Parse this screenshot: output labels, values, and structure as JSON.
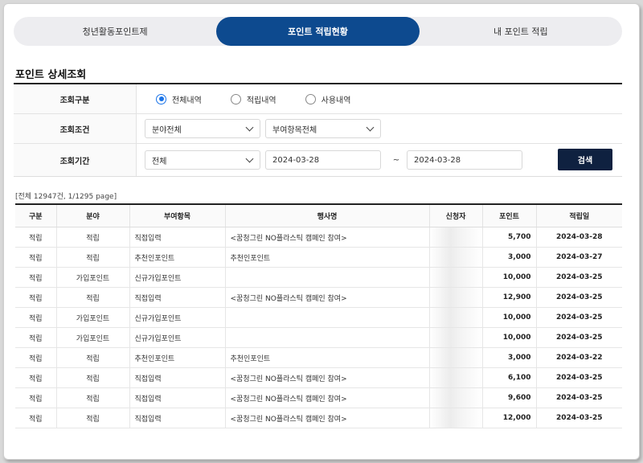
{
  "tabs": [
    {
      "label": "청년활동포인트제",
      "active": false
    },
    {
      "label": "포인트 적립현황",
      "active": true
    },
    {
      "label": "내 포인트 적립",
      "active": false
    }
  ],
  "section_title": "포인트 상세조회",
  "filter": {
    "type_label": "조회구분",
    "type_options": [
      "전체내역",
      "적립내역",
      "사용내역"
    ],
    "type_selected": 0,
    "condition_label": "조회조건",
    "field_select": "분야전체",
    "item_select": "부여항목전체",
    "period_label": "조회기간",
    "period_select": "전체",
    "date_from": "2024-03-28",
    "tilde": "~",
    "date_to": "2024-03-28",
    "search_button": "검색"
  },
  "summary": "[전체 12947건, 1/1295 page]",
  "table": {
    "headers": [
      "구분",
      "분야",
      "부여항목",
      "행사명",
      "신청자",
      "포인트",
      "적립일"
    ],
    "rows": [
      [
        "적립",
        "적립",
        "직접입력",
        "<꿈청그린 NO플라스틱 캠페인 참여>",
        "",
        "5,700",
        "2024-03-28"
      ],
      [
        "적립",
        "적립",
        "추천인포인트",
        "추천인포인트",
        "",
        "3,000",
        "2024-03-27"
      ],
      [
        "적립",
        "가입포인트",
        "신규가입포인트",
        "",
        "",
        "10,000",
        "2024-03-25"
      ],
      [
        "적립",
        "적립",
        "직접입력",
        "<꿈청그린 NO플라스틱 캠페인 참여>",
        "",
        "12,900",
        "2024-03-25"
      ],
      [
        "적립",
        "가입포인트",
        "신규가입포인트",
        "",
        "",
        "10,000",
        "2024-03-25"
      ],
      [
        "적립",
        "가입포인트",
        "신규가입포인트",
        "",
        "",
        "10,000",
        "2024-03-25"
      ],
      [
        "적립",
        "적립",
        "추천인포인트",
        "추천인포인트",
        "",
        "3,000",
        "2024-03-22"
      ],
      [
        "적립",
        "적립",
        "직접입력",
        "<꿈청그린 NO플라스틱 캠페인 참여>",
        "",
        "6,100",
        "2024-03-25"
      ],
      [
        "적립",
        "적립",
        "직접입력",
        "<꿈청그린 NO플라스틱 캠페인 참여>",
        "",
        "9,600",
        "2024-03-25"
      ],
      [
        "적립",
        "적립",
        "직접입력",
        "<꿈청그린 NO플라스틱 캠페인 참여>",
        "",
        "12,000",
        "2024-03-25"
      ]
    ]
  }
}
